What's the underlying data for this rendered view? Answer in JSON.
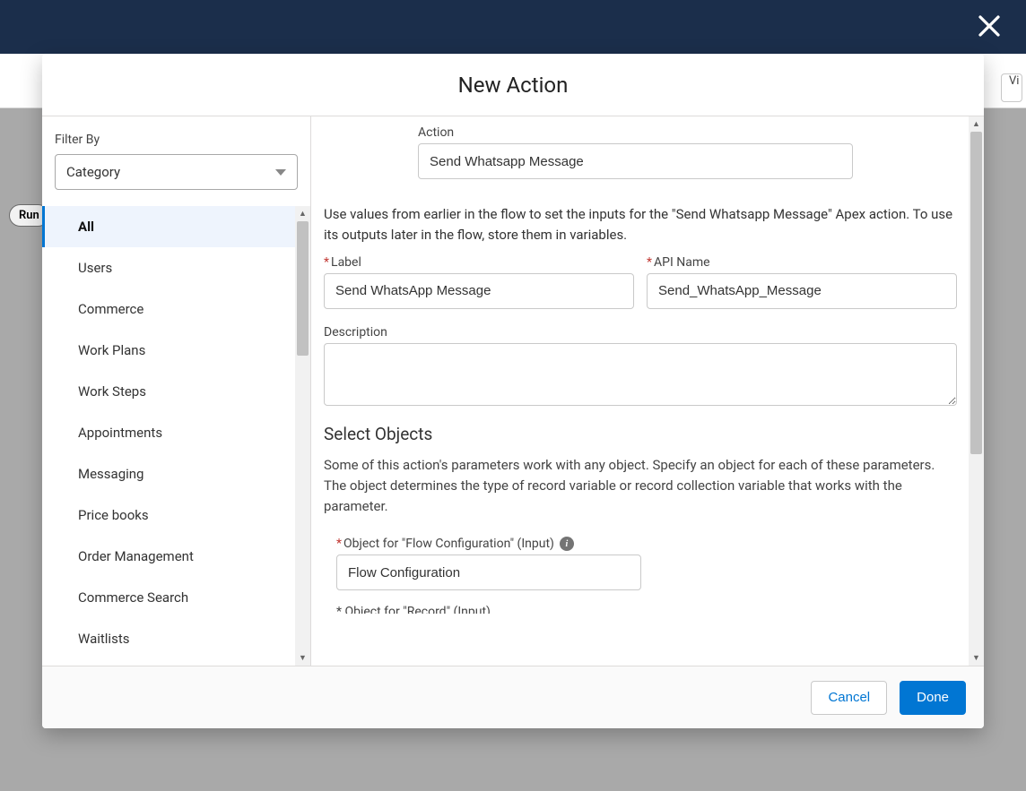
{
  "background": {
    "run_pill": "Run",
    "partial_button": "Vi"
  },
  "modal": {
    "title": "New Action",
    "footer": {
      "cancel": "Cancel",
      "done": "Done"
    }
  },
  "sidebar": {
    "filter_by_label": "Filter By",
    "filter_select_value": "Category",
    "categories": [
      {
        "label": "All",
        "active": true
      },
      {
        "label": "Users",
        "active": false
      },
      {
        "label": "Commerce",
        "active": false
      },
      {
        "label": "Work Plans",
        "active": false
      },
      {
        "label": "Work Steps",
        "active": false
      },
      {
        "label": "Appointments",
        "active": false
      },
      {
        "label": "Messaging",
        "active": false
      },
      {
        "label": "Price books",
        "active": false
      },
      {
        "label": "Order Management",
        "active": false
      },
      {
        "label": "Commerce Search",
        "active": false
      },
      {
        "label": "Waitlists",
        "active": false
      }
    ]
  },
  "form": {
    "action_label": "Action",
    "action_value": "Send Whatsapp Message",
    "help_text": "Use values from earlier in the flow to set the inputs for the \"Send Whatsapp Message\" Apex action. To use its outputs later in the flow, store them in variables.",
    "label_label": "Label",
    "label_value": "Send WhatsApp Message",
    "api_name_label": "API Name",
    "api_name_value": "Send_WhatsApp_Message",
    "description_label": "Description",
    "description_value": "",
    "section_title": "Select Objects",
    "section_help": "Some of this action's parameters work with any object. Specify an object for each of these parameters. The object determines the type of record variable or record collection variable that works with the parameter.",
    "object1_label": "Object for \"Flow Configuration\" (Input)",
    "object1_value": "Flow Configuration",
    "object2_label_partial": "* Object for \"Record\" (Input)"
  }
}
